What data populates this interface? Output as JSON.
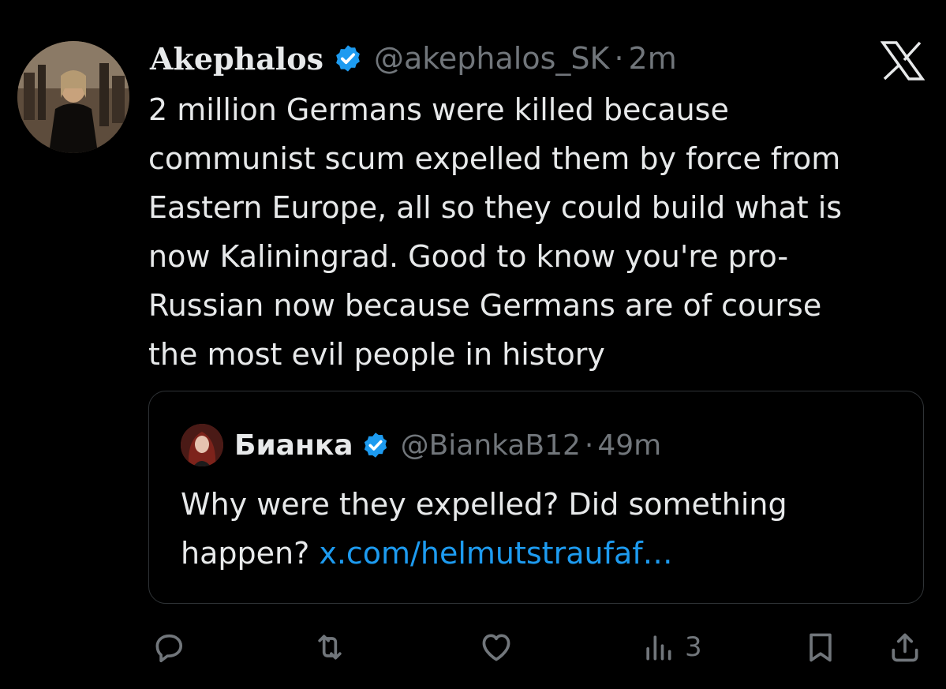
{
  "tweet": {
    "author_name": "Akephalos",
    "handle": "@akephalos_SK",
    "separator": "·",
    "time": "2m",
    "text": "2 million Germans were killed because\ncommunist scum expelled them by force from\nEastern Europe, all so they could build what is\nnow Kaliningrad. Good to know you're pro-\nRussian now because Germans are of course\nthe most evil people in history"
  },
  "quote": {
    "author_name": "Бианка",
    "handle": "@BiankaB12",
    "separator": "·",
    "time": "49m",
    "text": "Why were they expelled? Did something\nhappen? ",
    "link": "x.com/helmutstraufaf…"
  },
  "actions": {
    "views_count": "3"
  },
  "icons": {
    "app_logo": "x-logo-icon",
    "verified": "verified-badge-icon",
    "reply": "reply-icon",
    "retweet": "retweet-icon",
    "like": "heart-icon",
    "views": "analytics-icon",
    "bookmark": "bookmark-icon",
    "share": "share-icon"
  },
  "colors": {
    "background": "#000000",
    "text": "#e7e9ea",
    "muted": "#71767b",
    "accent": "#1d9bf0",
    "border": "#2f3336"
  }
}
